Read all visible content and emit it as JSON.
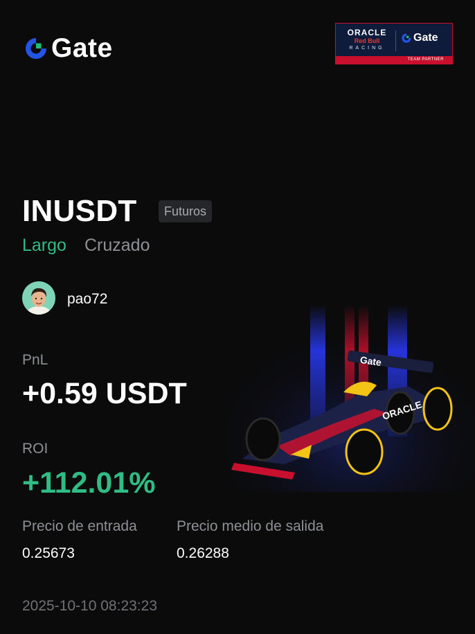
{
  "brand": {
    "name": "Gate",
    "logo_icon": "gate-logo-icon",
    "accent": "#2354e6",
    "accent2": "#18c07a"
  },
  "partner_badge": {
    "oracle": "ORACLE",
    "redbull": "Red Bull",
    "racing": "RACING",
    "gate": "Gate",
    "team_partner": "TEAM PARTNER"
  },
  "position": {
    "pair": "INUSDT",
    "market_type": "Futuros",
    "side": "Largo",
    "margin_mode": "Cruzado"
  },
  "user": {
    "username": "pao72",
    "avatar_icon": "user-avatar"
  },
  "stats": {
    "pnl_label": "PnL",
    "pnl_value": "+0.59 USDT",
    "roi_label": "ROI",
    "roi_value": "+112.01%",
    "entry_label": "Precio de entrada",
    "entry_value": "0.25673",
    "exit_label": "Precio medio de salida",
    "exit_value": "0.26288"
  },
  "timestamp": "2025-10-10 08:23:23",
  "colors": {
    "positive": "#2fbd85",
    "muted": "#8e9095",
    "background": "#0b0b0c"
  }
}
